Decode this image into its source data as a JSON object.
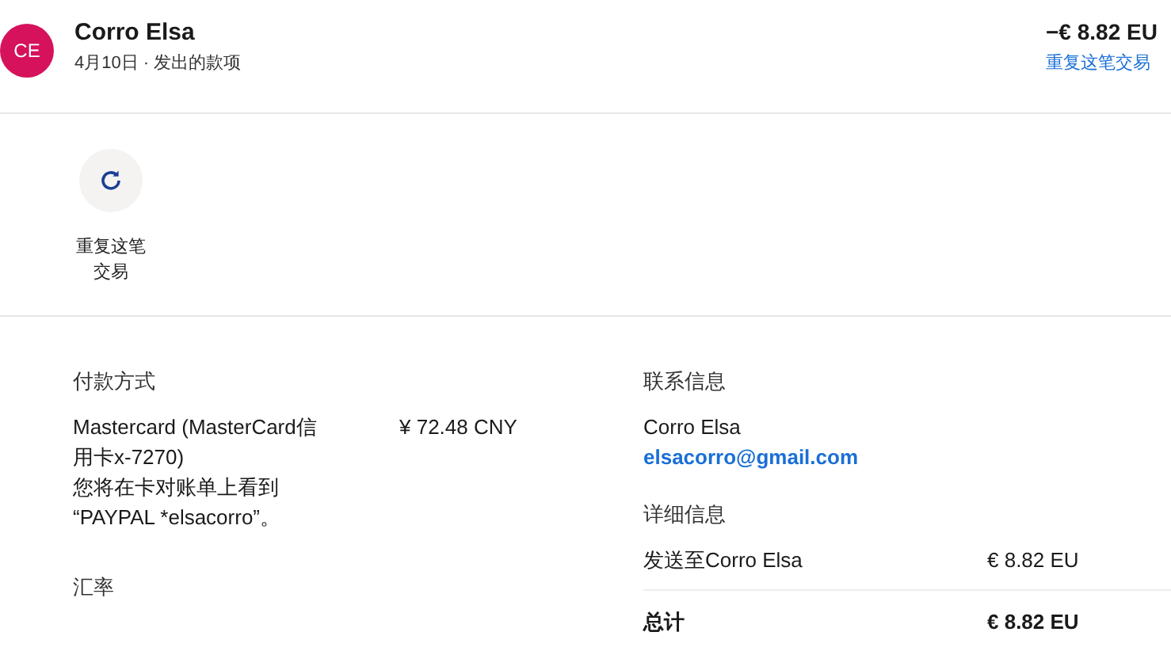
{
  "header": {
    "avatar": "CE",
    "name": "Corro Elsa",
    "subtitle": "4月10日 · 发出的款项",
    "amount": "−€ 8.82 EU",
    "repeat_link": "重复这笔交易"
  },
  "action": {
    "label": "重复这笔交易"
  },
  "payment": {
    "title": "付款方式",
    "method": "Mastercard (MasterCard信用卡x-7270)",
    "note": "您将在卡对账单上看到 “PAYPAL *elsacorro”。",
    "amount": "¥ 72.48 CNY"
  },
  "exchange": {
    "title": "汇率"
  },
  "contact": {
    "title": "联系信息",
    "name": "Corro Elsa",
    "email": "elsacorro@gmail.com"
  },
  "details": {
    "title": "详细信息",
    "rows": [
      {
        "label": "发送至Corro Elsa",
        "amount": "€ 8.82 EU"
      }
    ],
    "total_label": "总计",
    "total_amount": "€ 8.82 EU"
  }
}
